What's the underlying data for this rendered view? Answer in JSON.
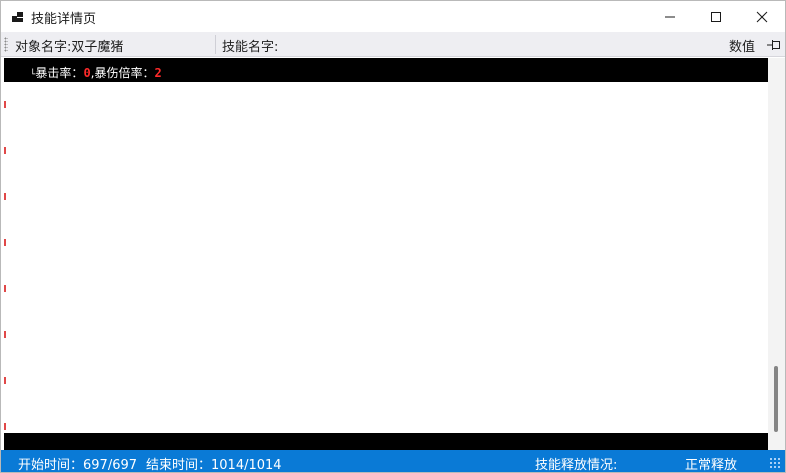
{
  "window": {
    "title": "技能详情页"
  },
  "toolbar": {
    "object_name": "对象名字:双子魔猪",
    "skill_name": "技能名字:",
    "value_label": "数值"
  },
  "content": {
    "line1": {
      "prefix": "└",
      "label1": "暴击率：",
      "value1": "0",
      "sep": ",",
      "label2": "暴伤倍率：",
      "value2": "2"
    }
  },
  "statusbar": {
    "start_time": "开始时间：697/697",
    "end_time": "结束时间：1014/1014",
    "release_label": "技能释放情况:",
    "release_status": "正常释放"
  },
  "colors": {
    "statusbar_bg": "#0a7ad6",
    "value_red": "#ff2a2a",
    "content_bar": "#000000"
  }
}
